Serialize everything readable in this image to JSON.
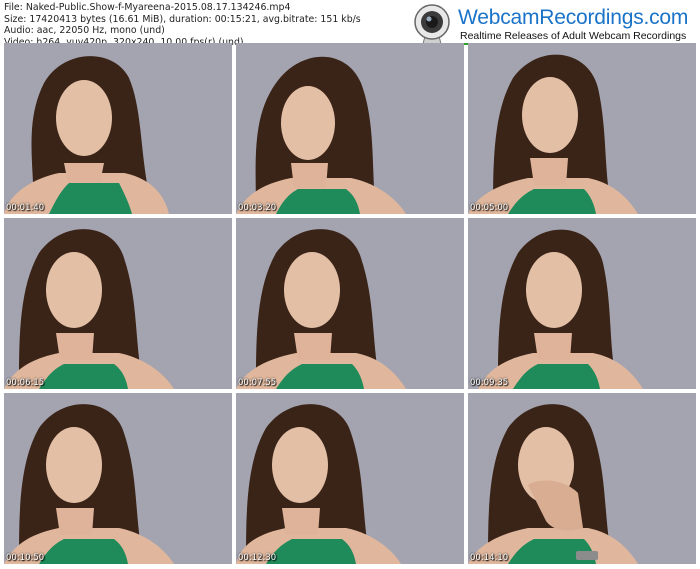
{
  "file_info": {
    "file": "File: Naked-Public.Show-f-Myareena-2015.08.17.134246.mp4",
    "size": "Size: 17420413 bytes (16.61 MiB), duration: 00:15:21, avg.bitrate: 151 kb/s",
    "audio": "Audio: aac, 22050 Hz, mono (und)",
    "video": "Video: h264, yuv420p, 320x240, 10.00 fps(r) (und)"
  },
  "logo": {
    "title": "WebcamRecordings.com",
    "tagline": "Realtime Releases of Adult Webcam Recordings",
    "icon": "webcam-icon",
    "title_color": "#1a73c8",
    "accent_color": "#2aa12a"
  },
  "thumbnails": [
    {
      "timestamp": "00:01:40"
    },
    {
      "timestamp": "00:03:20"
    },
    {
      "timestamp": "00:05:00"
    },
    {
      "timestamp": "00:06:15"
    },
    {
      "timestamp": "00:07:55"
    },
    {
      "timestamp": "00:09:35"
    },
    {
      "timestamp": "00:10:50"
    },
    {
      "timestamp": "00:12:30"
    },
    {
      "timestamp": "00:14:10"
    }
  ]
}
